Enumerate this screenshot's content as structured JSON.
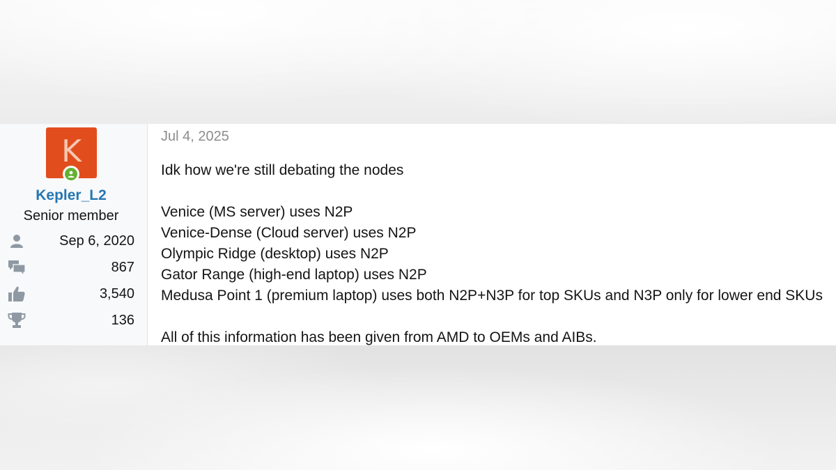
{
  "post": {
    "author": {
      "avatar_letter": "K",
      "avatar_color": "#e24d1e",
      "online_color": "#63b132",
      "username": "Kepler_L2",
      "user_title": "Senior member",
      "stats": {
        "joined": {
          "icon": "user-icon",
          "value": "Sep 6, 2020"
        },
        "messages": {
          "icon": "messages-icon",
          "value": "867"
        },
        "reactions": {
          "icon": "thumbs-up-icon",
          "value": "3,540"
        },
        "points": {
          "icon": "trophy-icon",
          "value": "136"
        }
      }
    },
    "date": "Jul 4, 2025",
    "paragraphs": [
      [
        "Idk how we're still debating the nodes"
      ],
      [
        "Venice (MS server) uses N2P",
        "Venice-Dense (Cloud server) uses N2P",
        "Olympic Ridge (desktop) uses N2P",
        "Gator Range (high-end laptop) uses N2P",
        "Medusa Point 1 (premium laptop) uses both N2P+N3P for top SKUs and N3P only for lower end SKUs"
      ],
      [
        "All of this information has been given from AMD to OEMs and AIBs."
      ]
    ]
  }
}
